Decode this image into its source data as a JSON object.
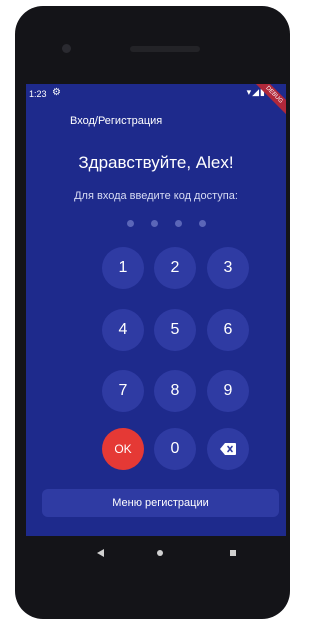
{
  "status": {
    "time": "1:23",
    "settings_icon": "⚙",
    "indicators": "▾◢▮",
    "debug_badge": "DEBUG"
  },
  "appbar": {
    "title": "Вход/Регистрация"
  },
  "main": {
    "greeting": "Здравствуйте, Alex!",
    "prompt": "Для входа введите код доступа:",
    "pin_length": 4,
    "pin_entered": 0
  },
  "keypad": {
    "keys": [
      "1",
      "2",
      "3",
      "4",
      "5",
      "6",
      "7",
      "8",
      "9"
    ],
    "ok_label": "OK",
    "zero_label": "0",
    "backspace_icon": "backspace-icon"
  },
  "menu": {
    "label": "Меню регистрации"
  },
  "colors": {
    "background": "#1e2a8c",
    "key": "#2f3ba3",
    "ok": "#e53935",
    "pin_dot": "#5b66b8"
  }
}
